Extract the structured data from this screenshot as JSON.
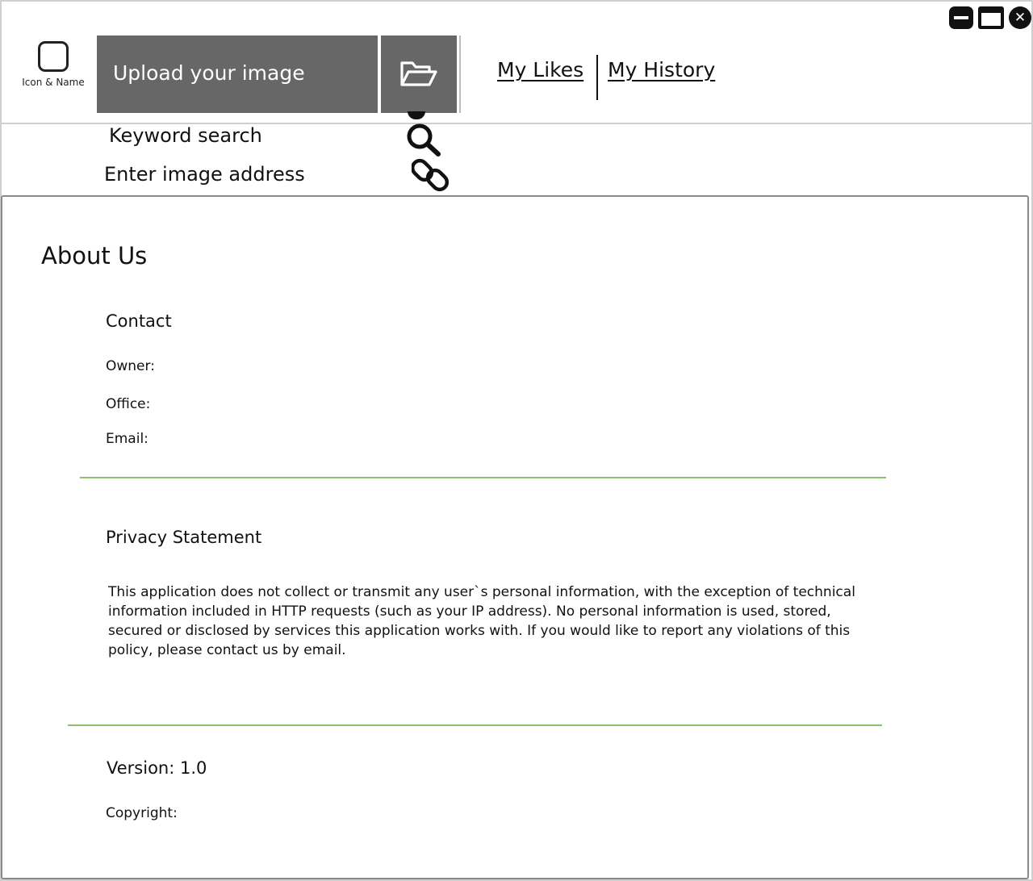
{
  "window": {
    "controls": {
      "minimize_icon": "minimize-icon",
      "maximize_icon": "maximize-icon",
      "close_icon": "close-icon"
    }
  },
  "header": {
    "logo_label": "Icon & Name",
    "upload_label": "Upload your image",
    "folder_icon": "folder-open-icon",
    "nav": {
      "likes": "My Likes",
      "history": "My History"
    }
  },
  "search": {
    "keyword_label": "Keyword search",
    "keyword_icon": "magnifier-icon",
    "address_label": "Enter image address",
    "address_icon": "chain-link-icon"
  },
  "about": {
    "title": "About Us",
    "contact": {
      "heading": "Contact",
      "owner_label": "Owner:",
      "office_label": "Office:",
      "email_label": "Email:"
    },
    "privacy": {
      "heading": "Privacy Statement",
      "text": "This application does not collect or transmit any user`s personal information, with the exception of technical information included in HTTP requests (such as your IP address). No personal information is used, stored, secured or disclosed by services this application works with. If you would like to report any violations of this policy, please contact us by email."
    },
    "version_label": "Version: 1.0",
    "copyright_label": "Copyright:"
  },
  "colors": {
    "upload_bg": "#676767",
    "divider": "#8cbf6e",
    "frame": "#cfcfcf"
  }
}
